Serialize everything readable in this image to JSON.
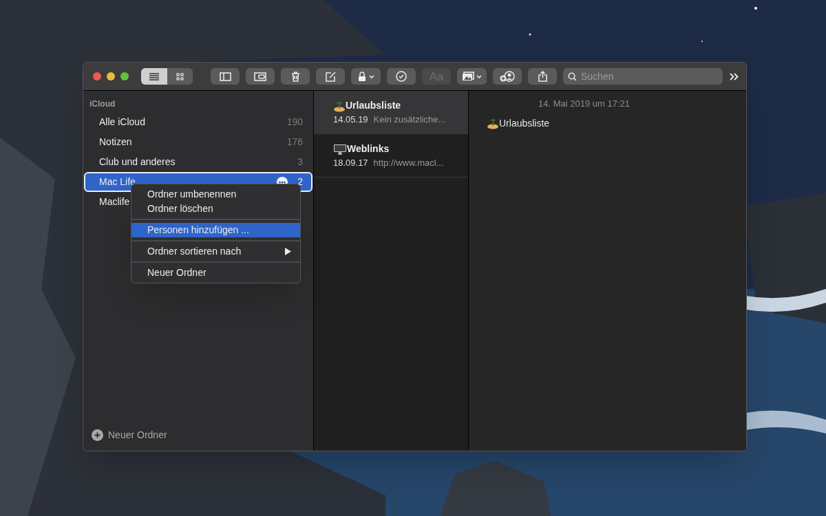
{
  "toolbar": {
    "view_modes": [
      {
        "kind": "list",
        "selected": true
      },
      {
        "kind": "gallery",
        "selected": false
      }
    ],
    "format_button": {
      "label": "Aa",
      "disabled": true
    },
    "search": {
      "placeholder": "Suchen"
    }
  },
  "sidebar": {
    "section": "iCloud",
    "items": [
      {
        "name": "Alle iCloud",
        "count": "190",
        "selected": false
      },
      {
        "name": "Notizen",
        "count": "176",
        "selected": false
      },
      {
        "name": "Club und anderes",
        "count": "3",
        "selected": false
      },
      {
        "name": "Mac Life",
        "count": "2",
        "selected": true
      },
      {
        "name": "Maclife",
        "selected": false
      }
    ],
    "new_folder": "Neuer Ordner"
  },
  "context_menu": {
    "groups": [
      [
        {
          "label": "Ordner umbenennen",
          "selected": false,
          "submenu": false
        },
        {
          "label": "Ordner löschen",
          "selected": false,
          "submenu": false
        }
      ],
      [
        {
          "label": "Personen hinzufügen ...",
          "selected": true,
          "submenu": false
        }
      ],
      [
        {
          "label": "Ordner sortieren nach",
          "selected": false,
          "submenu": true
        }
      ],
      [
        {
          "label": "Neuer Ordner",
          "selected": false,
          "submenu": false
        }
      ]
    ]
  },
  "notes": [
    {
      "kind": "island",
      "title": "Urlaubsliste",
      "date": "14.05.19",
      "preview": "Kein zusätzliche...",
      "selected": true
    },
    {
      "kind": "computer",
      "title": "Weblinks",
      "date": "18.09.17",
      "preview": "http://www.macl...",
      "selected": false
    }
  ],
  "editor": {
    "date": "14. Mai 2019 um 17:21",
    "kind": "island",
    "body": "Urlaubsliste"
  }
}
